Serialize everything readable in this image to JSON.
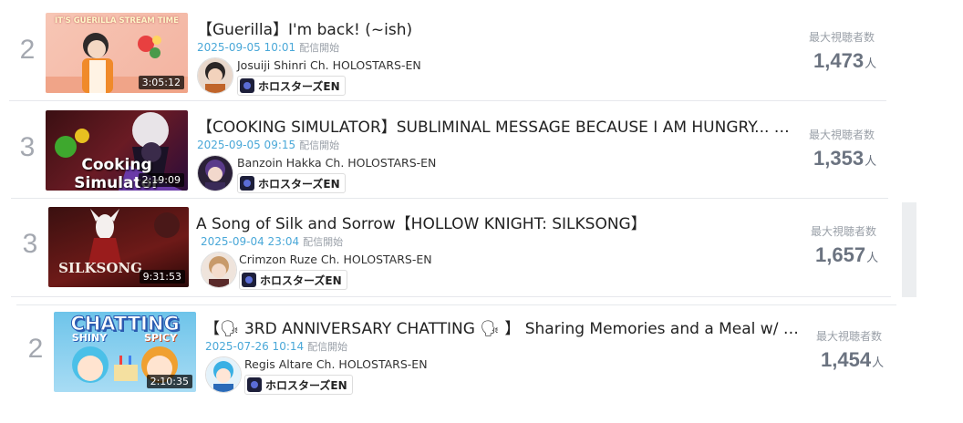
{
  "colors": {
    "rank": "#a4a8b0",
    "date": "#4aa8d8",
    "stat_value": "#6b7380",
    "stat_label": "#9aa0a8"
  },
  "rows": [
    {
      "rank": "2",
      "thumb_caption": "IT'S GUERILLA STREAM TIME",
      "duration": "3:05:12",
      "title": "【Guerilla】I'm back! (~ish)",
      "date": "2025-09-05 10:01",
      "date_label": "配信開始",
      "channel": "Josuiji Shinri Ch. HOLOSTARS-EN",
      "badge": "ホロスターズEN",
      "stat_label": "最大視聴者数",
      "stat_value": "1,473",
      "stat_unit": "人"
    },
    {
      "rank": "3",
      "thumb_caption": "Cooking Simulator",
      "duration": "2:19:09",
      "title": "【COOKING SIMULATOR】SUBLIMINAL MESSAGE BECAUSE I AM HUNGRY... …",
      "date": "2025-09-05 09:15",
      "date_label": "配信開始",
      "channel": "Banzoin Hakka Ch. HOLOSTARS-EN",
      "badge": "ホロスターズEN",
      "stat_label": "最大視聴者数",
      "stat_value": "1,353",
      "stat_unit": "人"
    },
    {
      "rank": "3",
      "thumb_caption": "SILKSONG",
      "duration": "9:31:53",
      "title": "A Song of Silk and Sorrow【HOLLOW KNIGHT: SILKSONG】",
      "date": "2025-09-04 23:04",
      "date_label": "配信開始",
      "channel": "Crimzon Ruze Ch. HOLOSTARS-EN",
      "badge": "ホロスターズEN",
      "stat_label": "最大視聴者数",
      "stat_value": "1,657",
      "stat_unit": "人"
    },
    {
      "rank": "2",
      "thumb_caption": "CHATTING",
      "thumb_caption2": "SHINY",
      "thumb_caption3": "SPICY",
      "duration": "2:10:35",
      "title": "【🗣 3RD ANNIVERSARY CHATTING 🗣 】 Sharing Memories and a Meal w/ …",
      "date": "2025-07-26 10:14",
      "date_label": "配信開始",
      "channel": "Regis Altare Ch. HOLOSTARS-EN",
      "badge": "ホロスターズEN",
      "stat_label": "最大視聴者数",
      "stat_value": "1,454",
      "stat_unit": "人"
    }
  ]
}
